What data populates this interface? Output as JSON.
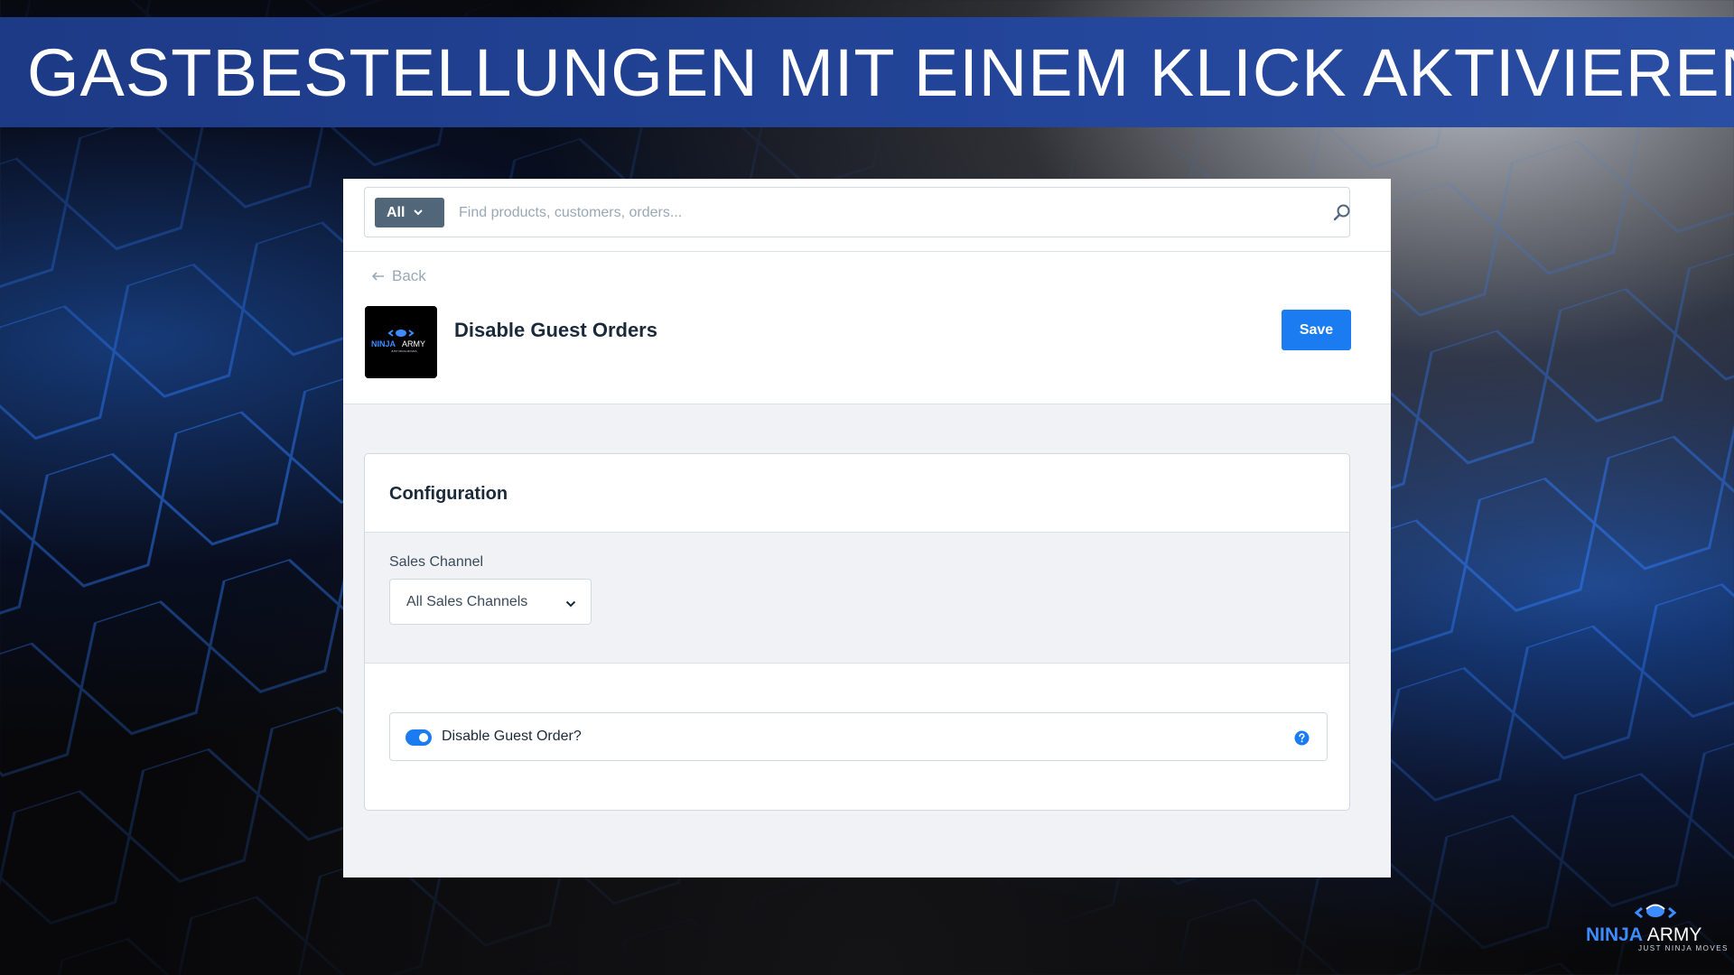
{
  "banner": {
    "title": "GASTBESTELLUNGEN MIT EINEM KLICK AKTIVIEREN"
  },
  "search": {
    "scope_label": "All",
    "placeholder": "Find products, customers, orders..."
  },
  "header": {
    "back_label": "Back",
    "app_title": "Disable Guest Orders",
    "save_label": "Save",
    "app_logo": {
      "ninja_text": "NINJA",
      "army_text": "ARMY",
      "tagline": "JUST NINJA MOVES"
    }
  },
  "configuration": {
    "title": "Configuration",
    "sales_channel": {
      "label": "Sales Channel",
      "selected": "All Sales Channels"
    },
    "disable_guest_order": {
      "label": "Disable Guest Order?",
      "enabled": true
    }
  },
  "brand": {
    "ninja_text": "NINJA",
    "army_text": "ARMY",
    "tagline": "JUST NINJA MOVES"
  },
  "colors": {
    "banner": "#23459a",
    "accent": "#1b7cf2",
    "scope_button": "#52667a",
    "title_text": "#1a2a3b"
  }
}
